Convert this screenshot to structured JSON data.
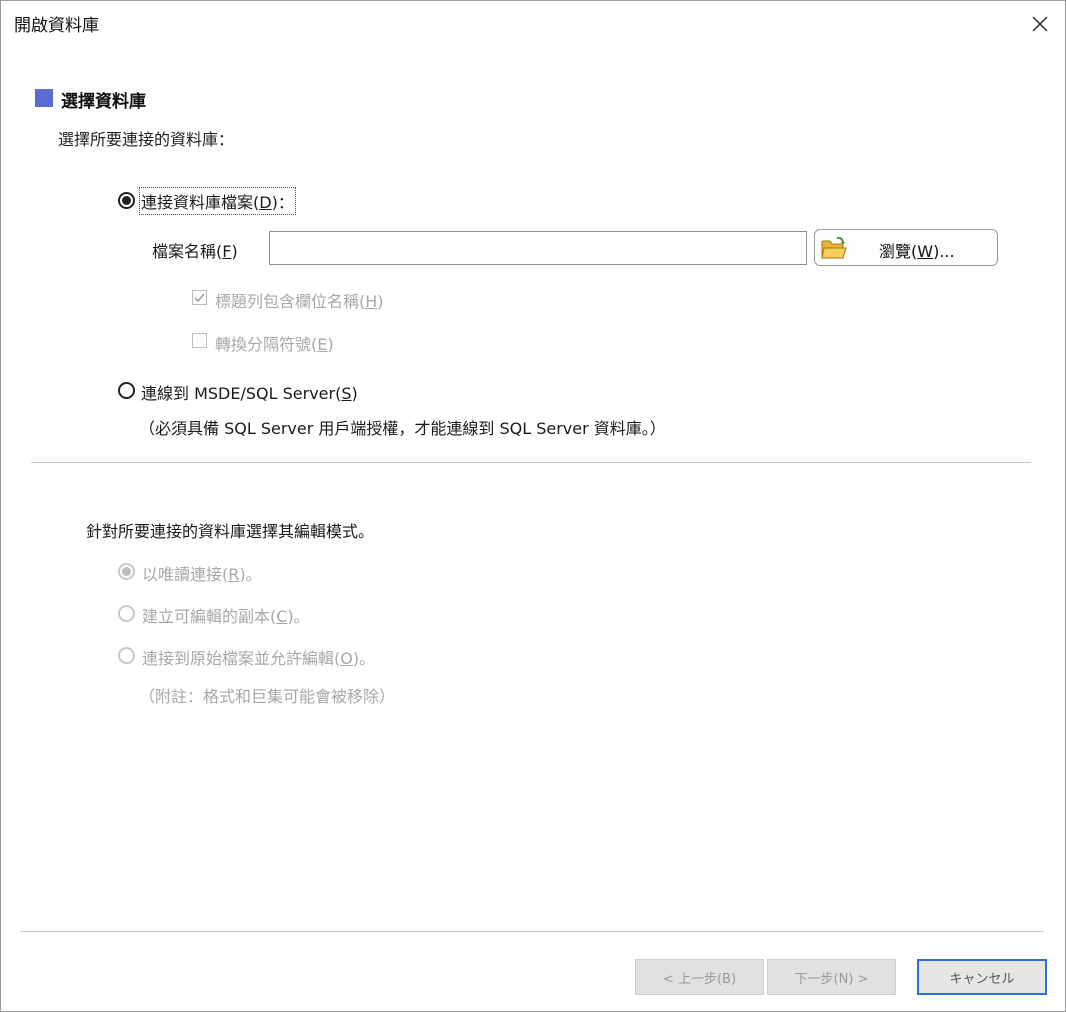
{
  "window": {
    "title": "開啟資料庫"
  },
  "section": {
    "title": "選擇資料庫",
    "description": "選擇所要連接的資料庫："
  },
  "option_file": {
    "prefix": "連接資料庫檔案(",
    "key": "D",
    "suffix": ")：",
    "selected": true
  },
  "file_name": {
    "prefix": "檔案名稱(",
    "key": "F",
    "suffix": ")",
    "value": ""
  },
  "browse": {
    "prefix": "瀏覽(",
    "key": "W",
    "suffix": ")..."
  },
  "checkbox_header": {
    "prefix": "標題列包含欄位名稱(",
    "key": "H",
    "suffix": ")",
    "checked": true
  },
  "checkbox_delimiter": {
    "prefix": "轉換分隔符號(",
    "key": "E",
    "suffix": ")",
    "checked": false
  },
  "option_sql": {
    "prefix": "連線到 MSDE/SQL Server(",
    "key": "S",
    "suffix": ")",
    "note": "（必須具備 SQL Server 用戶端授權，才能連線到 SQL Server 資料庫。）"
  },
  "edit_mode": {
    "title": "針對所要連接的資料庫選擇其編輯模式。",
    "readonly": {
      "prefix": "以唯讀連接(",
      "key": "R",
      "suffix": ")。"
    },
    "copy": {
      "prefix": "建立可編輯的副本(",
      "key": "C",
      "suffix": ")。"
    },
    "original": {
      "prefix": "連接到原始檔案並允許編輯(",
      "key": "O",
      "suffix": ")。"
    },
    "note": "（附註：格式和巨集可能會被移除）"
  },
  "footer": {
    "back": "< 上一步(B)",
    "next": "下一步(N) >",
    "cancel": "キャンセル"
  },
  "colors": {
    "accent": "#5b6bd1",
    "focus": "#2f6fd6"
  },
  "icons": {
    "close": "close-icon",
    "folder": "folder-open-icon"
  }
}
